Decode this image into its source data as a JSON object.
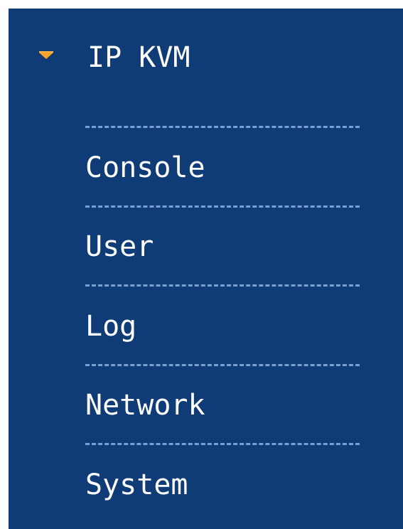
{
  "menu": {
    "title": "IP KVM",
    "header_icon": "caret-down-icon",
    "items": [
      {
        "label": "Console"
      },
      {
        "label": "User"
      },
      {
        "label": "Log"
      },
      {
        "label": "Network"
      },
      {
        "label": "System"
      }
    ]
  },
  "colors": {
    "panel_background": "#0f3b77",
    "text": "#ffffff",
    "divider": "#7aa0d3",
    "accent": "#f6a52a"
  }
}
